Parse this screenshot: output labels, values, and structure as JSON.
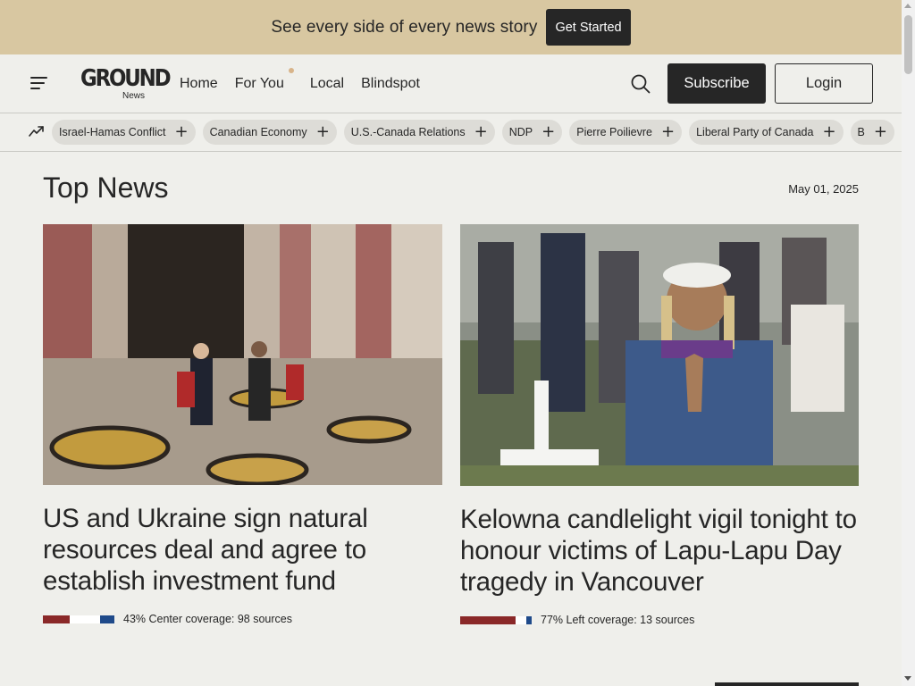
{
  "promo": {
    "text": "See every side of every news story",
    "button": "Get Started"
  },
  "header": {
    "logo_main": "GROUND",
    "logo_sub": "News",
    "nav": [
      {
        "label": "Home"
      },
      {
        "label": "For You",
        "has_dot": true
      },
      {
        "label": "Local"
      },
      {
        "label": "Blindspot"
      }
    ],
    "subscribe": "Subscribe",
    "login": "Login"
  },
  "topics": [
    "Israel-Hamas Conflict",
    "Canadian Economy",
    "U.S.-Canada Relations",
    "NDP",
    "Pierre Poilievre",
    "Liberal Party of Canada",
    "B"
  ],
  "main": {
    "title": "Top News",
    "date": "May 01, 2025",
    "stories": [
      {
        "title": "US and Ukraine sign natural resources deal and agree to establish investment fund",
        "coverage": "43% Center coverage: 98 sources",
        "bias": {
          "left": 0.37,
          "center": 0.43,
          "right": 0.2
        }
      },
      {
        "title": "Kelowna candlelight vigil tonight to honour victims of Lapu-Lapu Day tragedy in Vancouver",
        "coverage": "77% Left coverage: 13 sources",
        "bias": {
          "left": 0.77,
          "center": 0.15,
          "right": 0.08
        }
      }
    ]
  },
  "colors": {
    "banner": "#d8c7a1",
    "background": "#efefeb",
    "dark": "#262626",
    "bias_left": "#8a2828",
    "bias_center": "#ffffff",
    "bias_right": "#1f4a8a"
  },
  "icons": [
    "menu-icon",
    "search-icon",
    "trending-icon",
    "plus-icon"
  ]
}
